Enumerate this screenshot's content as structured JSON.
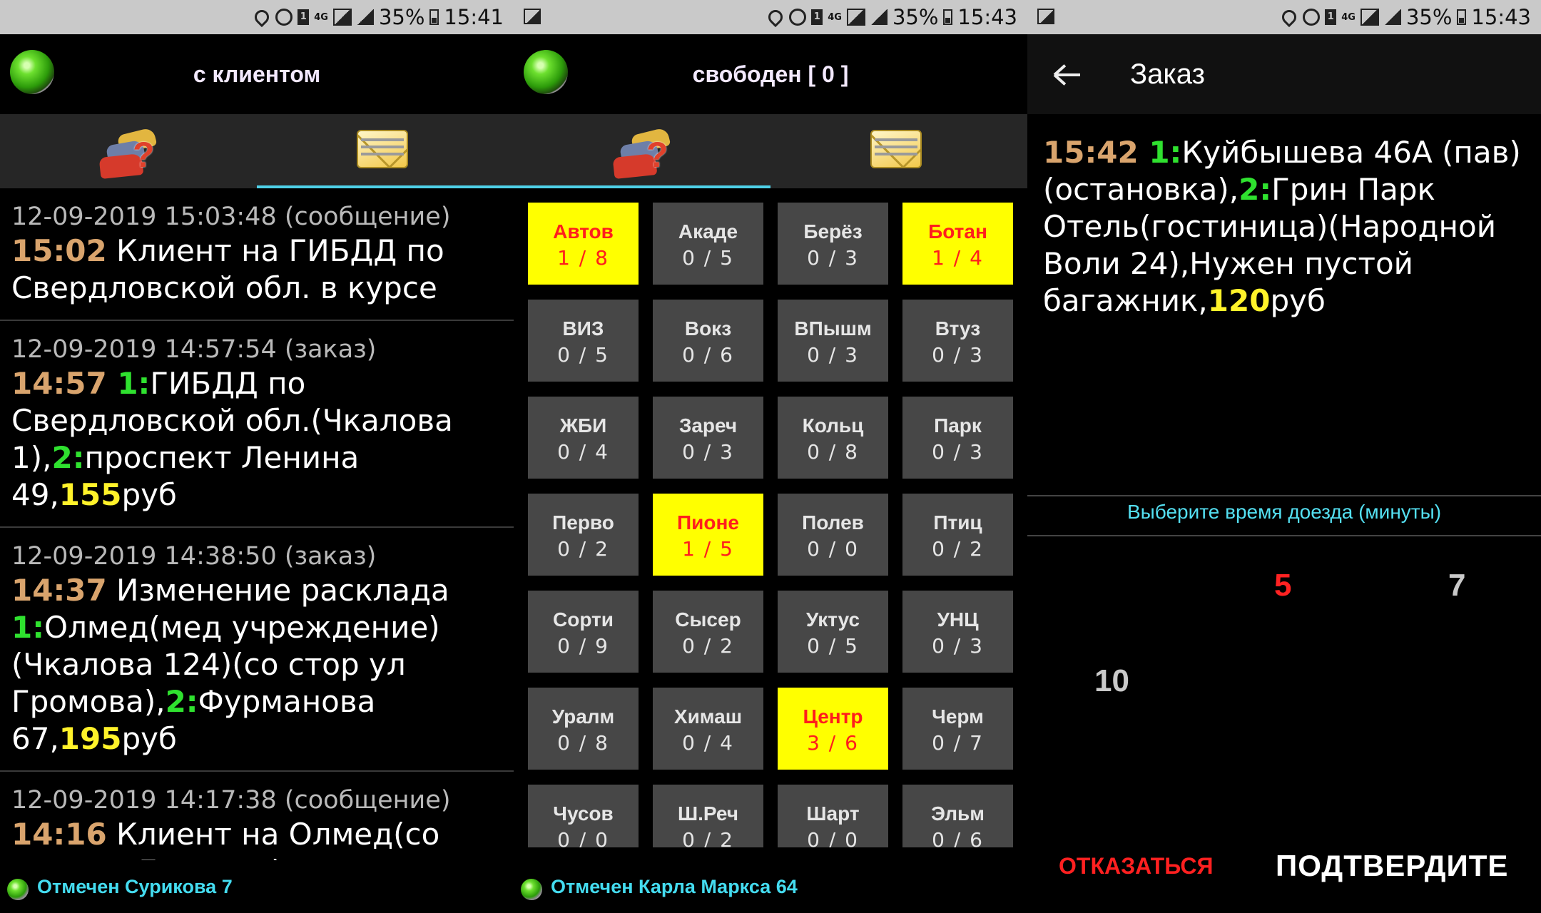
{
  "panel1": {
    "status": {
      "battery": "35%",
      "time": "15:41"
    },
    "title": "с клиентом",
    "messages": [
      {
        "meta": "12-09-2019 15:03:48 (сообщение)",
        "time": "15:02",
        "text": " Клиент на ГИБДД по Свердловской обл. в курсе"
      },
      {
        "meta": "12-09-2019 14:57:54 (заказ)",
        "time": "14:57",
        "n1": " 1:",
        "a1": "ГИБДД по Свердловской обл.(Чкалова 1),",
        "n2": "2:",
        "a2": "проспект Ленина 49,",
        "price": "155",
        "cur": "руб"
      },
      {
        "meta": "12-09-2019 14:38:50 (заказ)",
        "time": "14:37",
        "pre": " Изменение расклада ",
        "n1": "1:",
        "a1": "Олмед(мед учреждение)(Чкалова 124)(со стор ул Громова),",
        "n2": "2:",
        "a2": "Фурманова 67,",
        "price": "195",
        "cur": "руб"
      },
      {
        "meta": "12-09-2019 14:17:38 (сообщение)",
        "time": "14:16",
        "text": " Клиент на Олмед(со стор ул Громова) в курсе"
      }
    ],
    "bottom": "Отмечен Сурикова 7"
  },
  "panel2": {
    "status": {
      "battery": "35%",
      "time": "15:43"
    },
    "title": "свободен [ 0 ]",
    "zones": [
      {
        "name": "Автов",
        "count": "1 / 8",
        "hl": true
      },
      {
        "name": "Акаде",
        "count": "0 / 5",
        "hl": false
      },
      {
        "name": "Берёз",
        "count": "0 / 3",
        "hl": false
      },
      {
        "name": "Ботан",
        "count": "1 / 4",
        "hl": true
      },
      {
        "name": "ВИЗ",
        "count": "0 / 5",
        "hl": false
      },
      {
        "name": "Вокз",
        "count": "0 / 6",
        "hl": false
      },
      {
        "name": "ВПышм",
        "count": "0 / 3",
        "hl": false
      },
      {
        "name": "Втуз",
        "count": "0 / 3",
        "hl": false
      },
      {
        "name": "ЖБИ",
        "count": "0 / 4",
        "hl": false
      },
      {
        "name": "Зареч",
        "count": "0 / 3",
        "hl": false
      },
      {
        "name": "Кольц",
        "count": "0 / 8",
        "hl": false
      },
      {
        "name": "Парк",
        "count": "0 / 3",
        "hl": false
      },
      {
        "name": "Перво",
        "count": "0 / 2",
        "hl": false
      },
      {
        "name": "Пионе",
        "count": "1 / 5",
        "hl": true
      },
      {
        "name": "Полев",
        "count": "0 / 0",
        "hl": false
      },
      {
        "name": "Птиц",
        "count": "0 / 2",
        "hl": false
      },
      {
        "name": "Сорти",
        "count": "0 / 9",
        "hl": false
      },
      {
        "name": "Сысер",
        "count": "0 / 2",
        "hl": false
      },
      {
        "name": "Уктус",
        "count": "0 / 5",
        "hl": false
      },
      {
        "name": "УНЦ",
        "count": "0 / 3",
        "hl": false
      },
      {
        "name": "Уралм",
        "count": "0 / 8",
        "hl": false
      },
      {
        "name": "Химаш",
        "count": "0 / 4",
        "hl": false
      },
      {
        "name": "Центр",
        "count": "3 / 6",
        "hl": true
      },
      {
        "name": "Черм",
        "count": "0 / 7",
        "hl": false
      },
      {
        "name": "Чусов",
        "count": "0 / 0",
        "hl": false
      },
      {
        "name": "Ш.Реч",
        "count": "0 / 2",
        "hl": false
      },
      {
        "name": "Шарт",
        "count": "0 / 0",
        "hl": false
      },
      {
        "name": "Эльм",
        "count": "0 / 6",
        "hl": false
      }
    ],
    "bottom": "Отмечен Карла Маркса 64"
  },
  "panel3": {
    "status": {
      "battery": "35%",
      "time": "15:43"
    },
    "title": "Заказ",
    "order": {
      "time": "15:42",
      "n1": " 1:",
      "a1": "Куйбышева 46А (пав)(остановка),",
      "n2": "2:",
      "a2": "Грин Парк Отель(гостиница)(Народной Воли 24),Нужен пустой багажник,",
      "price": "120",
      "cur": "руб"
    },
    "choose": "Выберите время доезда (минуты)",
    "times": [
      "5",
      "7",
      "10"
    ],
    "decline": "ОТКАЗАТЬСЯ",
    "confirm": "ПОДТВЕРДИТЕ"
  }
}
